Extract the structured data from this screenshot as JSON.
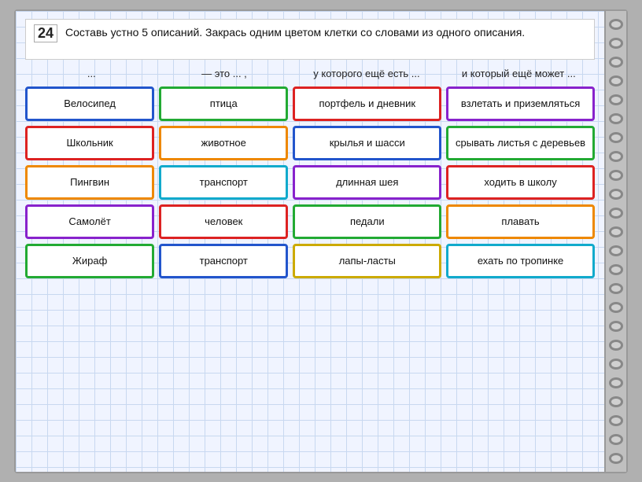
{
  "task": {
    "number": "24",
    "text": "Составь устно 5 описаний. Закрась одним цветом клетки со словами из одного описания."
  },
  "table": {
    "headers": [
      "...",
      "— это ... ,",
      "у которого ещё есть ...",
      "и который ещё может ..."
    ],
    "rows": [
      {
        "col1": {
          "text": "Велосипед",
          "border": "blue"
        },
        "col2": {
          "text": "птица",
          "border": "green"
        },
        "col3": {
          "text": "портфель и дневник",
          "border": "red"
        },
        "col4": {
          "text": "взлетать и приземляться",
          "border": "purple"
        }
      },
      {
        "col1": {
          "text": "Школьник",
          "border": "red"
        },
        "col2": {
          "text": "животное",
          "border": "orange"
        },
        "col3": {
          "text": "крылья и шасси",
          "border": "blue"
        },
        "col4": {
          "text": "срывать листья с деревьев",
          "border": "green"
        }
      },
      {
        "col1": {
          "text": "Пингвин",
          "border": "orange"
        },
        "col2": {
          "text": "транспорт",
          "border": "cyan"
        },
        "col3": {
          "text": "длинная шея",
          "border": "purple"
        },
        "col4": {
          "text": "ходить в школу",
          "border": "red"
        }
      },
      {
        "col1": {
          "text": "Самолёт",
          "border": "purple"
        },
        "col2": {
          "text": "человек",
          "border": "red"
        },
        "col3": {
          "text": "педали",
          "border": "green"
        },
        "col4": {
          "text": "плавать",
          "border": "orange"
        }
      },
      {
        "col1": {
          "text": "Жираф",
          "border": "green"
        },
        "col2": {
          "text": "транспорт",
          "border": "blue"
        },
        "col3": {
          "text": "лапы-ласты",
          "border": "yellow"
        },
        "col4": {
          "text": "ехать по тропинке",
          "border": "cyan"
        }
      }
    ]
  }
}
